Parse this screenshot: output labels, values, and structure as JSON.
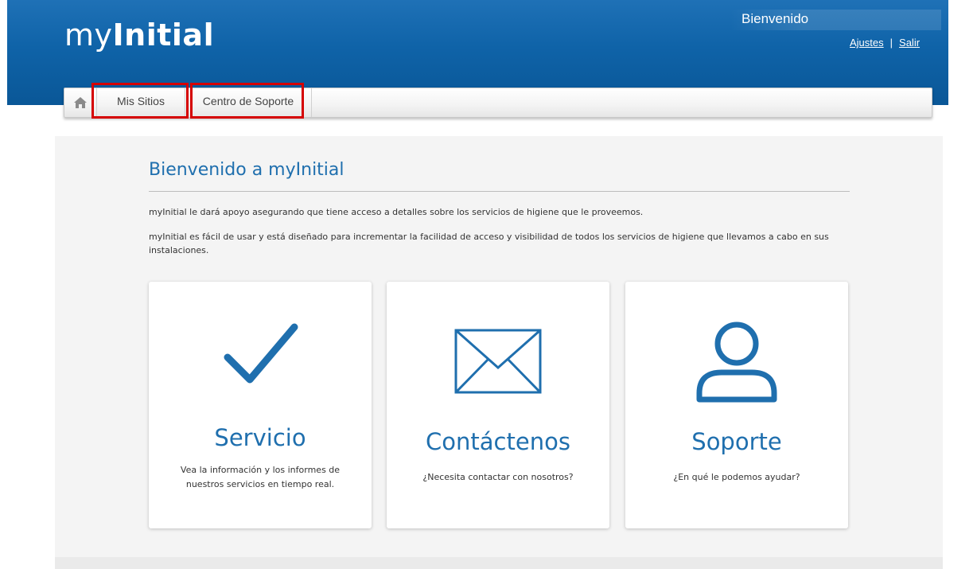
{
  "header": {
    "logo_light": "my",
    "logo_bold": "Initial",
    "welcome": "Bienvenido",
    "links": {
      "settings": "Ajustes",
      "separator": "|",
      "logout": "Salir"
    }
  },
  "nav": {
    "home_icon": "home-icon",
    "tabs": [
      {
        "label": "Mis Sitios"
      },
      {
        "label": "Centro de Soporte"
      }
    ]
  },
  "main": {
    "title": "Bienvenido a myInitial",
    "paragraphs": [
      "myInitial le dará apoyo asegurando que tiene acceso a detalles sobre los servicios de higiene que le proveemos.",
      "myInitial es fácil de usar y está diseñado para incrementar la facilidad de acceso y visibilidad de todos los servicios de higiene que llevamos a cabo en sus instalaciones."
    ],
    "cards": [
      {
        "icon": "checkmark-icon",
        "title": "Servicio",
        "desc_line1": "Vea la información y los informes de",
        "desc_line2": "nuestros servicios en tiempo real."
      },
      {
        "icon": "envelope-icon",
        "title": "Contáctenos",
        "desc": "¿Necesita contactar con nosotros?"
      },
      {
        "icon": "user-icon",
        "title": "Soporte",
        "desc": "¿En qué le podemos ayudar?"
      }
    ]
  },
  "colors": {
    "header_blue": "#0f63a8",
    "accent_blue": "#1f6fae",
    "highlight_red": "#d50000"
  }
}
